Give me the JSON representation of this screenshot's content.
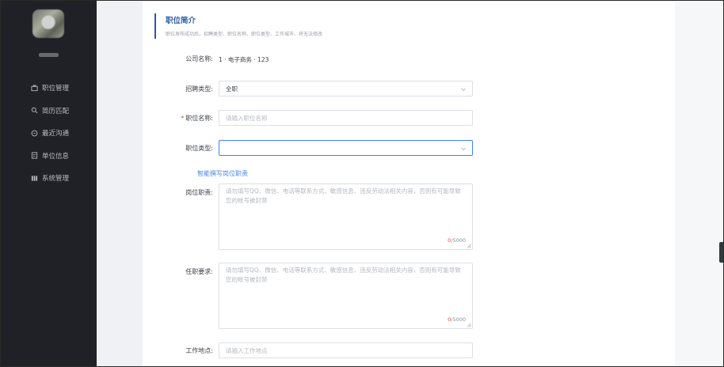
{
  "sidebar": {
    "items": [
      {
        "label": "职位管理",
        "icon": "briefcase-icon"
      },
      {
        "label": "简历匹配",
        "icon": "search-icon"
      },
      {
        "label": "最近沟通",
        "icon": "chat-icon"
      },
      {
        "label": "单位信息",
        "icon": "document-icon"
      },
      {
        "label": "系统管理",
        "icon": "grid-icon"
      }
    ]
  },
  "section": {
    "title": "职位简介",
    "subtitle": "职位发布成功后，招聘类型、职位名称、职位类型、工作城市、将无法修改"
  },
  "form": {
    "company": {
      "label": "公司名称:",
      "value": "1 · 电子商务 · 123"
    },
    "recruit_type": {
      "label": "招聘类型:",
      "value": "全职"
    },
    "job_name": {
      "label": "职位名称:",
      "required_mark": "*",
      "placeholder": "请输入职位名称"
    },
    "job_type": {
      "label": "职位类型:",
      "value": ""
    },
    "ai_link": "智能撰写岗位职责",
    "duties": {
      "label": "岗位职责:",
      "placeholder": "请勿填写QQ、微信、电话等联系方式、敏感信息、违反劳动法相关内容，否则有可能导致您的帐号被封禁",
      "count_current": "0",
      "count_max": "/5000"
    },
    "requirements": {
      "label": "任职要求:",
      "placeholder": "请勿填写QQ、微信、电话等联系方式、敏感信息、违反劳动法相关内容，否则有可能导致您的帐号被封禁",
      "count_current": "0",
      "count_max": "/5000"
    },
    "location": {
      "label": "工作地点:",
      "placeholder": "请输入工作地点"
    }
  }
}
